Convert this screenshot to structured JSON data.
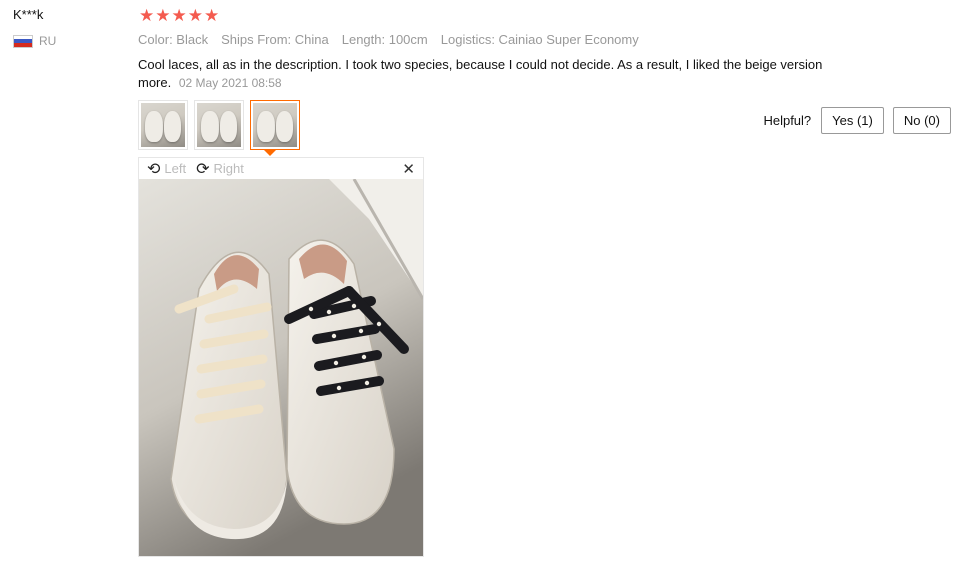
{
  "reviewer": {
    "name": "K***k",
    "country_code": "RU",
    "flag_colors": [
      "#ffffff",
      "#3b58c4",
      "#d52b1e"
    ]
  },
  "rating": {
    "stars": 5,
    "max": 5,
    "star_glyph": "★",
    "color": "#f45b4f"
  },
  "attributes": {
    "color": "Color: Black",
    "ships_from": "Ships From: China",
    "length": "Length: 100cm",
    "logistics": "Logistics: Cainiao Super Economy"
  },
  "review": {
    "text": "Cool laces, all as in the description. I took two species, because I could not decide. As a result, I liked the beige version more.",
    "date": "02 May 2021 08:58"
  },
  "thumbnails": [
    {
      "name": "review-photo-1",
      "active": false
    },
    {
      "name": "review-photo-2",
      "active": false
    },
    {
      "name": "review-photo-3",
      "active": true
    }
  ],
  "viewer": {
    "rotate_left_label": "Left",
    "rotate_right_label": "Right",
    "rotate_left_icon": "rotate-left-icon",
    "rotate_right_icon": "rotate-right-icon",
    "close_icon": "close-icon",
    "image_subject": "white sneakers with beige and black polka-dot laces"
  },
  "helpful": {
    "label": "Helpful?",
    "yes_label": "Yes (1)",
    "no_label": "No (0)"
  },
  "colors": {
    "accent": "#ff6a00",
    "muted": "#999999"
  }
}
